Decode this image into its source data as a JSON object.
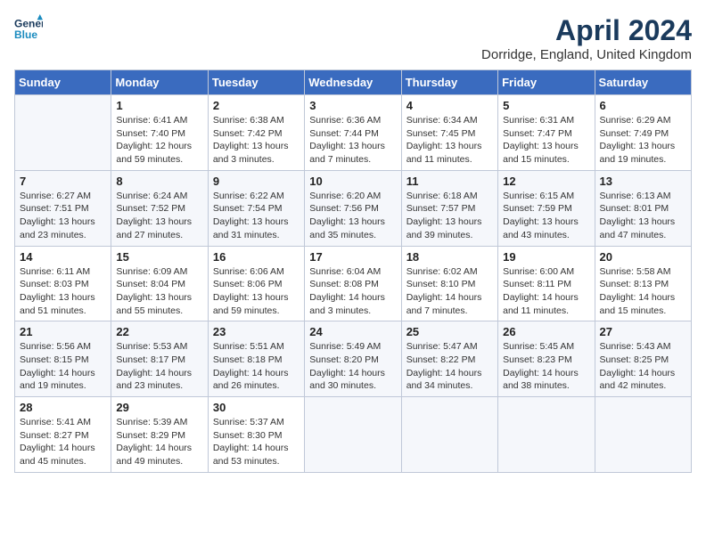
{
  "header": {
    "logo_line1": "General",
    "logo_line2": "Blue",
    "month_year": "April 2024",
    "location": "Dorridge, England, United Kingdom"
  },
  "weekdays": [
    "Sunday",
    "Monday",
    "Tuesday",
    "Wednesday",
    "Thursday",
    "Friday",
    "Saturday"
  ],
  "weeks": [
    [
      {
        "day": "",
        "sunrise": "",
        "sunset": "",
        "daylight": ""
      },
      {
        "day": "1",
        "sunrise": "Sunrise: 6:41 AM",
        "sunset": "Sunset: 7:40 PM",
        "daylight": "Daylight: 12 hours and 59 minutes."
      },
      {
        "day": "2",
        "sunrise": "Sunrise: 6:38 AM",
        "sunset": "Sunset: 7:42 PM",
        "daylight": "Daylight: 13 hours and 3 minutes."
      },
      {
        "day": "3",
        "sunrise": "Sunrise: 6:36 AM",
        "sunset": "Sunset: 7:44 PM",
        "daylight": "Daylight: 13 hours and 7 minutes."
      },
      {
        "day": "4",
        "sunrise": "Sunrise: 6:34 AM",
        "sunset": "Sunset: 7:45 PM",
        "daylight": "Daylight: 13 hours and 11 minutes."
      },
      {
        "day": "5",
        "sunrise": "Sunrise: 6:31 AM",
        "sunset": "Sunset: 7:47 PM",
        "daylight": "Daylight: 13 hours and 15 minutes."
      },
      {
        "day": "6",
        "sunrise": "Sunrise: 6:29 AM",
        "sunset": "Sunset: 7:49 PM",
        "daylight": "Daylight: 13 hours and 19 minutes."
      }
    ],
    [
      {
        "day": "7",
        "sunrise": "Sunrise: 6:27 AM",
        "sunset": "Sunset: 7:51 PM",
        "daylight": "Daylight: 13 hours and 23 minutes."
      },
      {
        "day": "8",
        "sunrise": "Sunrise: 6:24 AM",
        "sunset": "Sunset: 7:52 PM",
        "daylight": "Daylight: 13 hours and 27 minutes."
      },
      {
        "day": "9",
        "sunrise": "Sunrise: 6:22 AM",
        "sunset": "Sunset: 7:54 PM",
        "daylight": "Daylight: 13 hours and 31 minutes."
      },
      {
        "day": "10",
        "sunrise": "Sunrise: 6:20 AM",
        "sunset": "Sunset: 7:56 PM",
        "daylight": "Daylight: 13 hours and 35 minutes."
      },
      {
        "day": "11",
        "sunrise": "Sunrise: 6:18 AM",
        "sunset": "Sunset: 7:57 PM",
        "daylight": "Daylight: 13 hours and 39 minutes."
      },
      {
        "day": "12",
        "sunrise": "Sunrise: 6:15 AM",
        "sunset": "Sunset: 7:59 PM",
        "daylight": "Daylight: 13 hours and 43 minutes."
      },
      {
        "day": "13",
        "sunrise": "Sunrise: 6:13 AM",
        "sunset": "Sunset: 8:01 PM",
        "daylight": "Daylight: 13 hours and 47 minutes."
      }
    ],
    [
      {
        "day": "14",
        "sunrise": "Sunrise: 6:11 AM",
        "sunset": "Sunset: 8:03 PM",
        "daylight": "Daylight: 13 hours and 51 minutes."
      },
      {
        "day": "15",
        "sunrise": "Sunrise: 6:09 AM",
        "sunset": "Sunset: 8:04 PM",
        "daylight": "Daylight: 13 hours and 55 minutes."
      },
      {
        "day": "16",
        "sunrise": "Sunrise: 6:06 AM",
        "sunset": "Sunset: 8:06 PM",
        "daylight": "Daylight: 13 hours and 59 minutes."
      },
      {
        "day": "17",
        "sunrise": "Sunrise: 6:04 AM",
        "sunset": "Sunset: 8:08 PM",
        "daylight": "Daylight: 14 hours and 3 minutes."
      },
      {
        "day": "18",
        "sunrise": "Sunrise: 6:02 AM",
        "sunset": "Sunset: 8:10 PM",
        "daylight": "Daylight: 14 hours and 7 minutes."
      },
      {
        "day": "19",
        "sunrise": "Sunrise: 6:00 AM",
        "sunset": "Sunset: 8:11 PM",
        "daylight": "Daylight: 14 hours and 11 minutes."
      },
      {
        "day": "20",
        "sunrise": "Sunrise: 5:58 AM",
        "sunset": "Sunset: 8:13 PM",
        "daylight": "Daylight: 14 hours and 15 minutes."
      }
    ],
    [
      {
        "day": "21",
        "sunrise": "Sunrise: 5:56 AM",
        "sunset": "Sunset: 8:15 PM",
        "daylight": "Daylight: 14 hours and 19 minutes."
      },
      {
        "day": "22",
        "sunrise": "Sunrise: 5:53 AM",
        "sunset": "Sunset: 8:17 PM",
        "daylight": "Daylight: 14 hours and 23 minutes."
      },
      {
        "day": "23",
        "sunrise": "Sunrise: 5:51 AM",
        "sunset": "Sunset: 8:18 PM",
        "daylight": "Daylight: 14 hours and 26 minutes."
      },
      {
        "day": "24",
        "sunrise": "Sunrise: 5:49 AM",
        "sunset": "Sunset: 8:20 PM",
        "daylight": "Daylight: 14 hours and 30 minutes."
      },
      {
        "day": "25",
        "sunrise": "Sunrise: 5:47 AM",
        "sunset": "Sunset: 8:22 PM",
        "daylight": "Daylight: 14 hours and 34 minutes."
      },
      {
        "day": "26",
        "sunrise": "Sunrise: 5:45 AM",
        "sunset": "Sunset: 8:23 PM",
        "daylight": "Daylight: 14 hours and 38 minutes."
      },
      {
        "day": "27",
        "sunrise": "Sunrise: 5:43 AM",
        "sunset": "Sunset: 8:25 PM",
        "daylight": "Daylight: 14 hours and 42 minutes."
      }
    ],
    [
      {
        "day": "28",
        "sunrise": "Sunrise: 5:41 AM",
        "sunset": "Sunset: 8:27 PM",
        "daylight": "Daylight: 14 hours and 45 minutes."
      },
      {
        "day": "29",
        "sunrise": "Sunrise: 5:39 AM",
        "sunset": "Sunset: 8:29 PM",
        "daylight": "Daylight: 14 hours and 49 minutes."
      },
      {
        "day": "30",
        "sunrise": "Sunrise: 5:37 AM",
        "sunset": "Sunset: 8:30 PM",
        "daylight": "Daylight: 14 hours and 53 minutes."
      },
      {
        "day": "",
        "sunrise": "",
        "sunset": "",
        "daylight": ""
      },
      {
        "day": "",
        "sunrise": "",
        "sunset": "",
        "daylight": ""
      },
      {
        "day": "",
        "sunrise": "",
        "sunset": "",
        "daylight": ""
      },
      {
        "day": "",
        "sunrise": "",
        "sunset": "",
        "daylight": ""
      }
    ]
  ]
}
